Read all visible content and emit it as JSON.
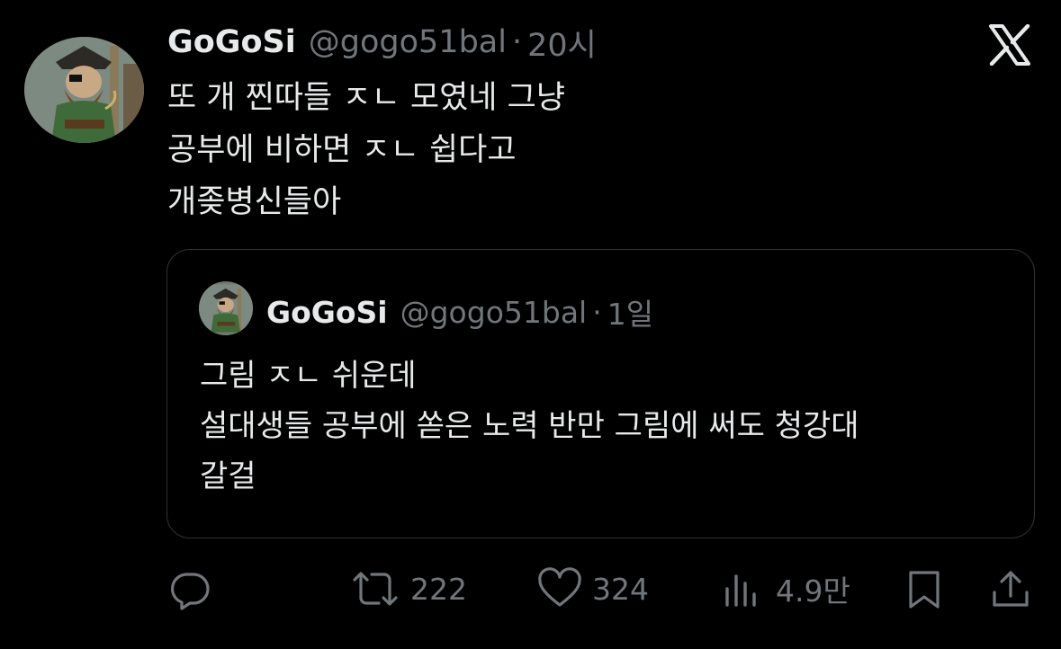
{
  "tweet": {
    "display_name": "GoGoSi",
    "handle": "@gogo51bal",
    "separator": "·",
    "time": "20시",
    "lines": [
      "또 개 찐따들 ㅈㄴ 모였네 그냥",
      "공부에 비하면 ㅈㄴ 쉽다고",
      "개좆병신들아"
    ]
  },
  "quoted_tweet": {
    "display_name": "GoGoSi",
    "handle": "@gogo51bal",
    "separator": "·",
    "time": "1일",
    "lines": [
      "그림 ㅈㄴ 쉬운데",
      "설대생들 공부에 쏟은 노력 반만 그림에 써도 청강대",
      "갈걸"
    ]
  },
  "actions": {
    "reply_icon": "reply-icon",
    "retweet_count": "222",
    "like_count": "324",
    "views_count": "4.9만",
    "bookmark_icon": "bookmark-icon",
    "share_icon": "share-icon"
  },
  "colors": {
    "background": "#000000",
    "text": "#e7e9ea",
    "muted": "#71767b",
    "border": "#2f3336"
  }
}
